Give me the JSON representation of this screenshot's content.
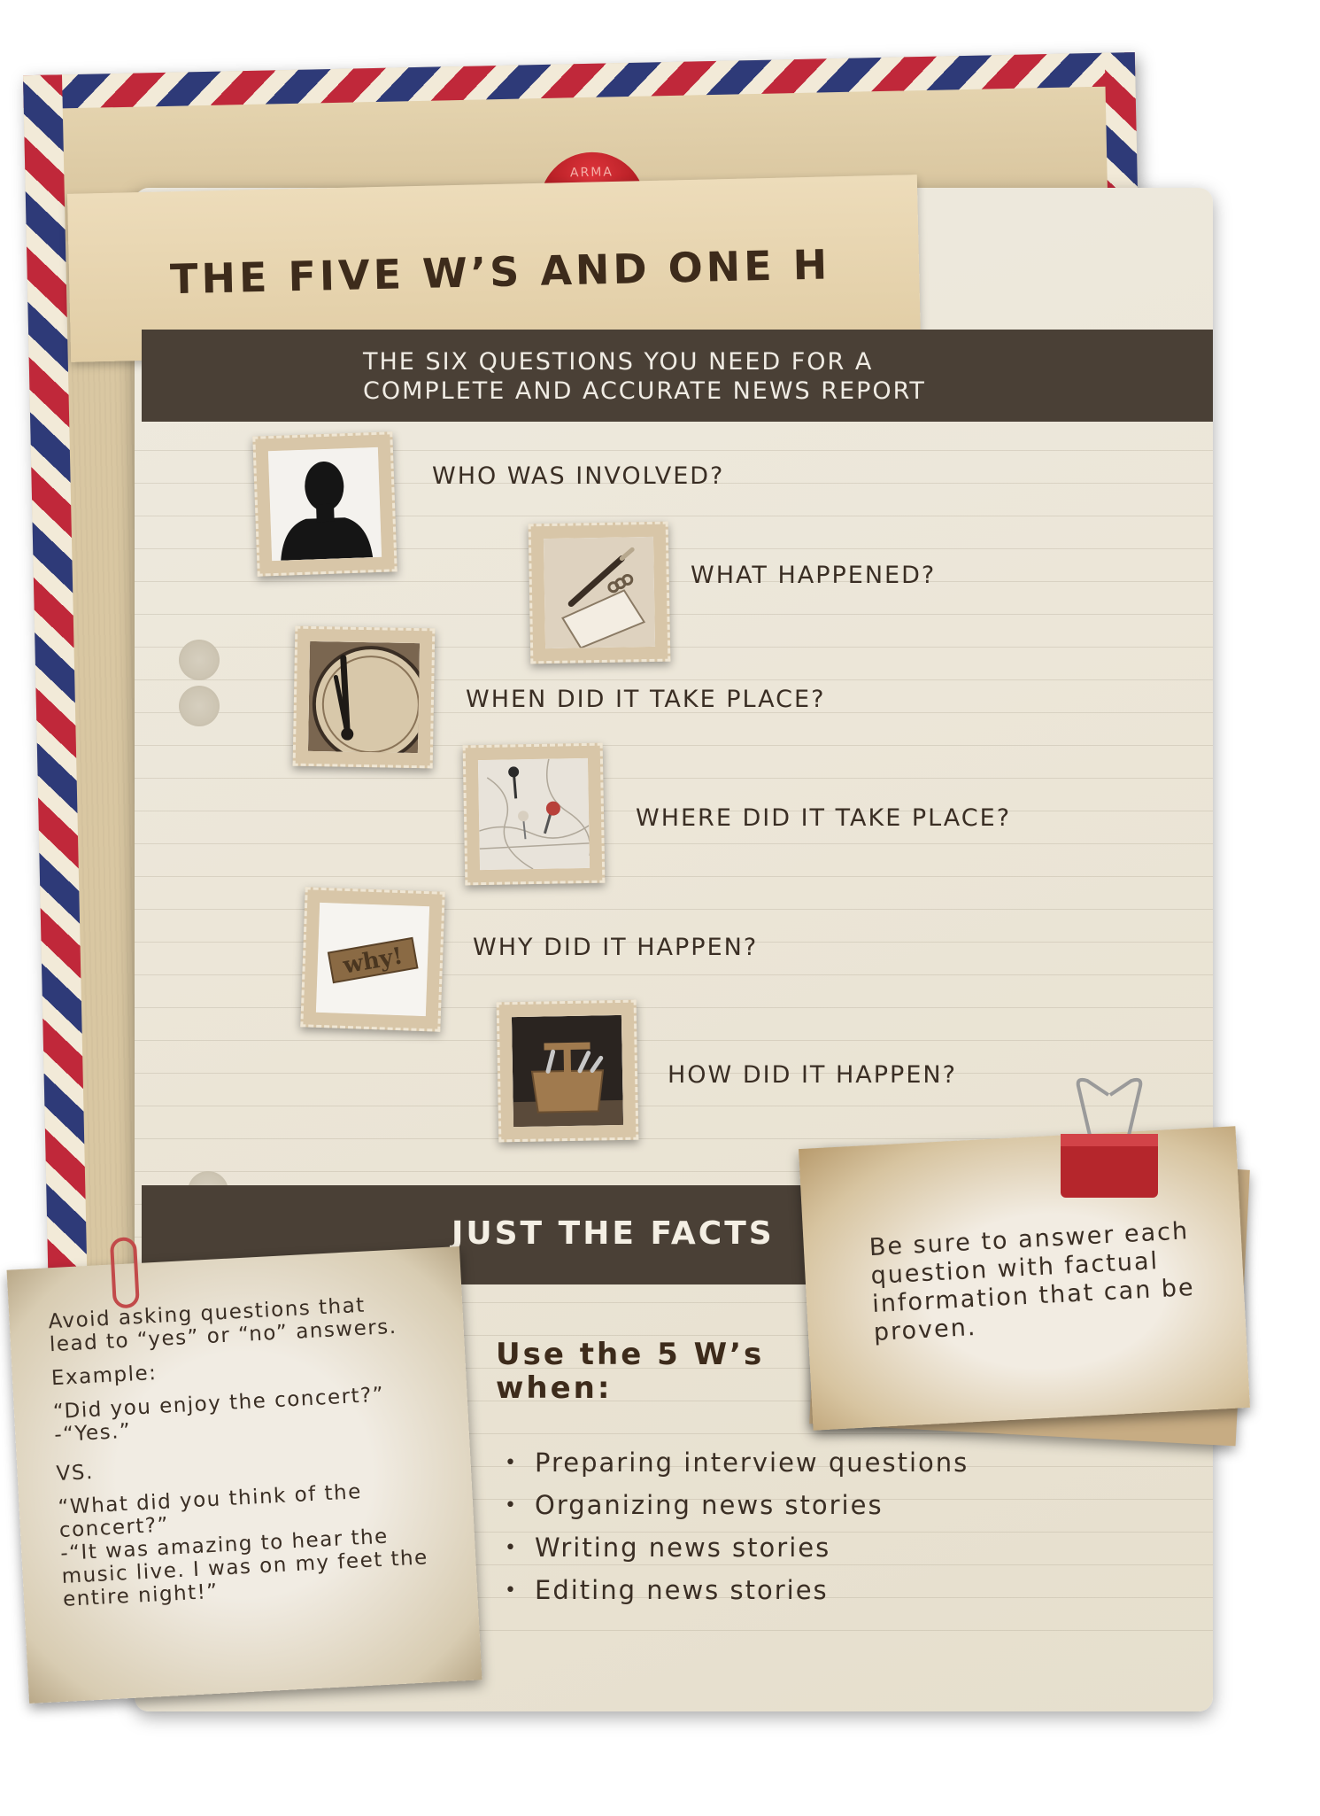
{
  "title": "THE FIVE W’S AND ONE H",
  "subtitle": "THE SIX QUESTIONS YOU NEED FOR A\nCOMPLETE AND ACCURATE NEWS REPORT",
  "questions": [
    {
      "text": "WHO WAS INVOLVED?",
      "icon": "silhouette-icon"
    },
    {
      "text": "WHAT HAPPENED?",
      "icon": "notebook-pen-icon"
    },
    {
      "text": "WHEN DID IT TAKE PLACE?",
      "icon": "clock-icon"
    },
    {
      "text": "WHERE DID IT TAKE PLACE?",
      "icon": "map-pin-icon"
    },
    {
      "text": "WHY DID IT HAPPEN?",
      "icon": "why-type-icon"
    },
    {
      "text": "HOW DID IT HAPPEN?",
      "icon": "toolbox-icon"
    }
  ],
  "facts_heading": "JUST THE FACTS",
  "clip_note": "Be sure to answer each question with factual information that can be proven.",
  "use_heading": "Use the 5 W’s when:",
  "uses": [
    "Preparing interview questions",
    "Organizing news stories",
    "Writing news stories",
    "Editing news stories"
  ],
  "note": {
    "intro": "Avoid asking questions that lead to “yes” or “no” answers.",
    "example_label": "Example:",
    "example_1": "“Did you enjoy the concert?”\n-“Yes.”",
    "vs": "VS.",
    "example_2": "“What did you think of the concert?”\n-“It was amazing to hear the music live. I was on my feet the entire night!”"
  },
  "seal_text": "ARMA",
  "colors": {
    "band": "#4a4036",
    "stripe_red": "#c0283a",
    "stripe_blue": "#2e3a78",
    "text_dark": "#3a2e24"
  }
}
